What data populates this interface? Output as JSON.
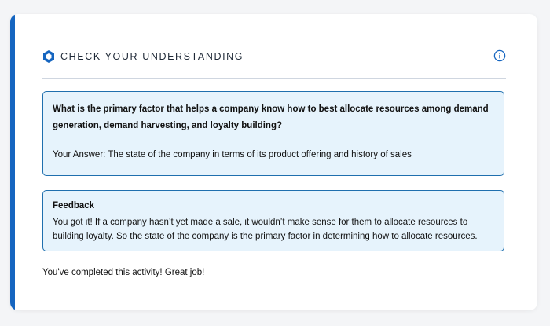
{
  "header": {
    "title": "CHECK YOUR UNDERSTANDING",
    "icon": "hexagon-icon",
    "info_icon": "info-icon"
  },
  "question": {
    "text": "What is the primary factor that helps a company know how to best allocate resources among demand generation, demand harvesting, and loyalty building?",
    "answer": "Your Answer: The state of the company in terms of its product offering and history of sales"
  },
  "feedback": {
    "title": "Feedback",
    "text": "You got it! If a company hasn’t yet made a sale, it wouldn’t make sense for them to allocate resources to building loyalty. So the state of the company is the primary factor in determining how to allocate resources."
  },
  "completion_message": "You've completed this activity! Great job!",
  "colors": {
    "accent": "#1565c0",
    "box_background": "#e6f3fc",
    "box_border": "#1f6fae"
  }
}
